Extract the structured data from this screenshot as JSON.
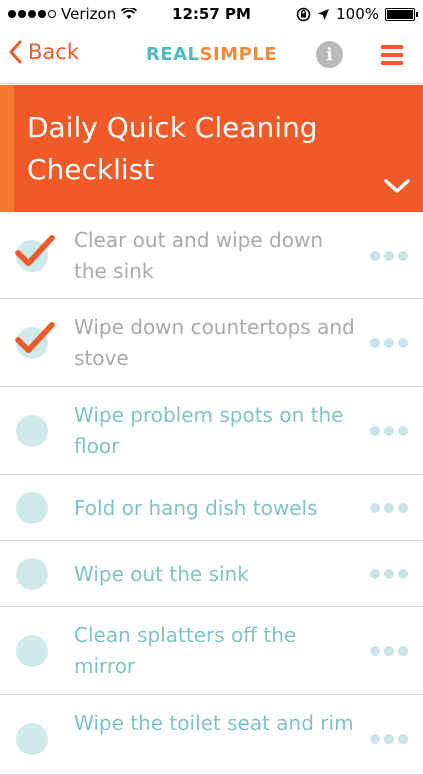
{
  "status": {
    "carrier": "Verizon",
    "time": "12:57 PM",
    "battery": "100%",
    "signal_bars": 4,
    "signal_total": 5
  },
  "nav": {
    "back_label": "Back",
    "brand_real": "REAL",
    "brand_simple": "SIMPLE",
    "info_glyph": "i"
  },
  "banner": {
    "title": "Daily Quick Cleaning Checklist"
  },
  "items": [
    {
      "text": "Clear out and wipe down the sink",
      "checked": true
    },
    {
      "text": "Wipe down countertops and stove",
      "checked": true
    },
    {
      "text": "Wipe problem spots on the floor",
      "checked": false
    },
    {
      "text": "Fold or hang dish towels",
      "checked": false
    },
    {
      "text": "Wipe out the sink",
      "checked": false
    },
    {
      "text": "Clean splatters off the mirror",
      "checked": false
    },
    {
      "text": "Wipe the toilet seat and rim",
      "checked": false
    }
  ],
  "colors": {
    "accent": "#ef5a2a",
    "banner": "#f05a28",
    "teal": "#4fbdc0",
    "orange": "#f28a3a",
    "circle": "#cfe9ea",
    "todo_text": "#7fc3c7",
    "done_text": "#a9a9a9"
  },
  "icons": {
    "back": "chevron-left-icon",
    "info": "info-icon",
    "menu": "hamburger-menu-icon",
    "expand": "chevron-down-icon",
    "more": "more-dots-icon",
    "check": "checkmark-icon"
  }
}
